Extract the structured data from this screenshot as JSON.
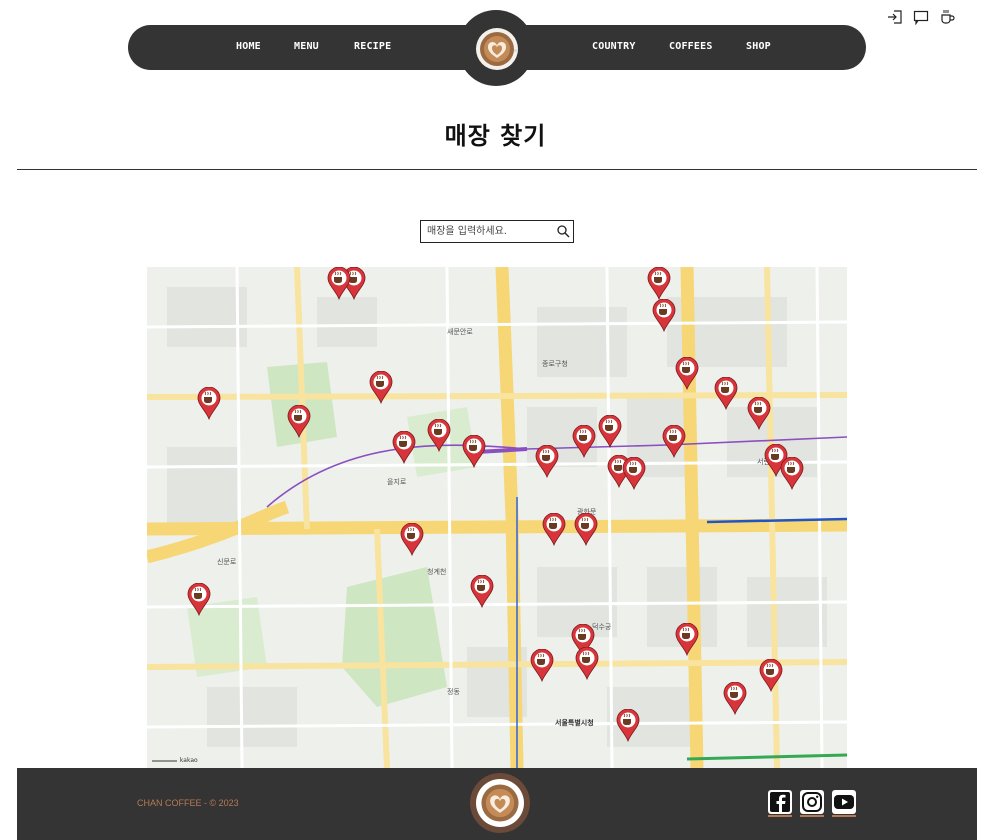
{
  "utility_icons": [
    "login-icon",
    "feedback-icon",
    "cafe-icon"
  ],
  "nav": {
    "left": [
      "HOME",
      "MENU",
      "RECIPE"
    ],
    "right": [
      "COUNTRY",
      "COFFEES",
      "SHOP"
    ]
  },
  "page_title": "매장 찾기",
  "search": {
    "placeholder": "매장을 입력하세요.",
    "value": ""
  },
  "map": {
    "provider_label": "kakao",
    "city_hall_label": "서울특별시청",
    "labels": [
      "세종대로",
      "종로구청",
      "광화문",
      "서울특별시청",
      "덕수궁",
      "청계천",
      "을지로",
      "무교로",
      "새문안로",
      "정동",
      "신문로",
      "서린동",
      "무교동",
      "태평로"
    ],
    "store_pin_count": 33
  },
  "footer": {
    "copyright": "CHAN COFFEE - © 2023",
    "social": [
      "facebook-icon",
      "instagram-icon",
      "youtube-icon"
    ]
  },
  "colors": {
    "nav_bg": "#343434",
    "pin": "#d8353b",
    "copyright": "#b57a55"
  }
}
